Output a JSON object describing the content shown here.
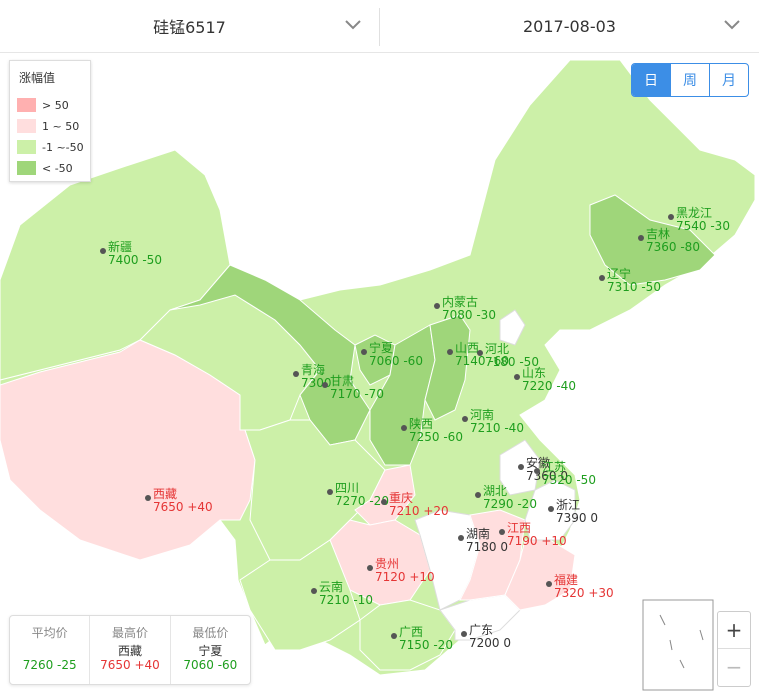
{
  "filters": {
    "product": "硅锰6517",
    "date": "2017-08-03"
  },
  "legend": {
    "title": "涨幅值",
    "items": [
      {
        "label": "> 50",
        "color": "#ffb0b0"
      },
      {
        "label": "1 ~ 50",
        "color": "#ffdede"
      },
      {
        "label": "-1 ~-50",
        "color": "#ccf0a8"
      },
      {
        "label": "< -50",
        "color": "#9fd67a"
      }
    ]
  },
  "period": {
    "day": "日",
    "week": "周",
    "month": "月",
    "active": "day"
  },
  "provinces": [
    {
      "name": "新疆",
      "value": "7400 -50",
      "tone": "g"
    },
    {
      "name": "西藏",
      "value": "7650 +40",
      "tone": "r"
    },
    {
      "name": "青海",
      "value": "7300",
      "tone": "g"
    },
    {
      "name": "甘肃",
      "value": "7170 -70",
      "tone": "g"
    },
    {
      "name": "宁夏",
      "value": "7060 -60",
      "tone": "g"
    },
    {
      "name": "内蒙古",
      "value": "7080 -30",
      "tone": "g"
    },
    {
      "name": "黑龙江",
      "value": "7540 -30",
      "tone": "g"
    },
    {
      "name": "吉林",
      "value": "7360 -80",
      "tone": "g"
    },
    {
      "name": "辽宁",
      "value": "7310 -50",
      "tone": "g"
    },
    {
      "name": "山西",
      "value": "7140 -60",
      "tone": "g"
    },
    {
      "name": "河北",
      "value": "7180 -50",
      "tone": "g"
    },
    {
      "name": "山东",
      "value": "7220 -40",
      "tone": "g"
    },
    {
      "name": "陕西",
      "value": "7250 -60",
      "tone": "g"
    },
    {
      "name": "河南",
      "value": "7210 -40",
      "tone": "g"
    },
    {
      "name": "四川",
      "value": "7270 -20",
      "tone": "g"
    },
    {
      "name": "重庆",
      "value": "7210 +20",
      "tone": "r"
    },
    {
      "name": "湖北",
      "value": "7290 -20",
      "tone": "g"
    },
    {
      "name": "安徽",
      "value": "7360 0",
      "tone": "k"
    },
    {
      "name": "江苏",
      "value": "7320 -50",
      "tone": "g"
    },
    {
      "name": "浙江",
      "value": "7390 0",
      "tone": "k"
    },
    {
      "name": "湖南",
      "value": "7180 0",
      "tone": "k"
    },
    {
      "name": "江西",
      "value": "7190 +10",
      "tone": "r"
    },
    {
      "name": "贵州",
      "value": "7120 +10",
      "tone": "r"
    },
    {
      "name": "福建",
      "value": "7320 +30",
      "tone": "r"
    },
    {
      "name": "云南",
      "value": "7210 -10",
      "tone": "g"
    },
    {
      "name": "广西",
      "value": "7150 -20",
      "tone": "g"
    },
    {
      "name": "广东",
      "value": "7200 0",
      "tone": "k"
    }
  ],
  "summary": {
    "avg_label": "平均价",
    "avg_value": "7260 -25",
    "max_label": "最高价",
    "max_name": "西藏",
    "max_value": "7650 +40",
    "min_label": "最低价",
    "min_name": "宁夏",
    "min_value": "7060 -60"
  },
  "zoom": {
    "plus": "+",
    "minus": "−"
  }
}
